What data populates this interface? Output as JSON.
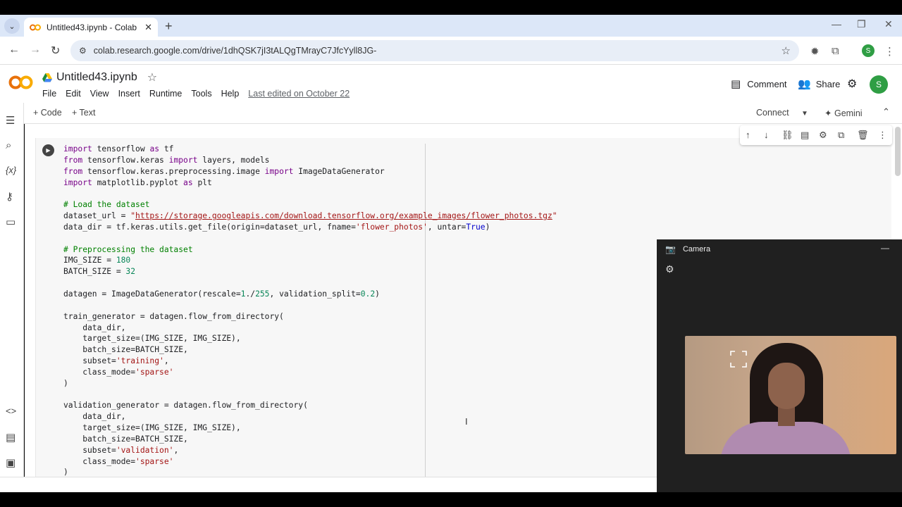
{
  "browser": {
    "tab_title": "Untitled43.ipynb - Colab",
    "url": "colab.research.google.com/drive/1dhQSK7jI3tALQgTMrayC7JfcYyll8JG-",
    "profile_initial": "S",
    "accent": "#dce7f8"
  },
  "colab": {
    "logo": "CO",
    "notebook_name": "Untitled43.ipynb",
    "menus": [
      "File",
      "Edit",
      "View",
      "Insert",
      "Runtime",
      "Tools",
      "Help"
    ],
    "last_edited": "Last edited on October 22",
    "comment_label": "Comment",
    "share_label": "Share",
    "avatar_initial": "S",
    "add_code_label": "+ Code",
    "add_text_label": "+ Text",
    "connect_label": "Connect",
    "gemini_label": "Gemini"
  },
  "code_lines": [
    "import tensorflow as tf",
    "from tensorflow.keras import layers, models",
    "from tensorflow.keras.preprocessing.image import ImageDataGenerator",
    "import matplotlib.pyplot as plt",
    "",
    "# Load the dataset",
    "dataset_url = \"https://storage.googleapis.com/download.tensorflow.org/example_images/flower_photos.tgz\"",
    "data_dir = tf.keras.utils.get_file(origin=dataset_url, fname='flower_photos', untar=True)",
    "",
    "# Preprocessing the dataset",
    "IMG_SIZE = 180",
    "BATCH_SIZE = 32",
    "",
    "datagen = ImageDataGenerator(rescale=1./255, validation_split=0.2)",
    "",
    "train_generator = datagen.flow_from_directory(",
    "    data_dir,",
    "    target_size=(IMG_SIZE, IMG_SIZE),",
    "    batch_size=BATCH_SIZE,",
    "    subset='training',",
    "    class_mode='sparse'",
    ")",
    "",
    "validation_generator = datagen.flow_from_directory(",
    "    data_dir,",
    "    target_size=(IMG_SIZE, IMG_SIZE),",
    "    batch_size=BATCH_SIZE,",
    "    subset='validation',",
    "    class_mode='sparse'",
    ")"
  ],
  "camera": {
    "title": "Camera"
  },
  "icons": {
    "rail": [
      "toc-icon",
      "search-icon",
      "variables-icon",
      "secrets-icon",
      "files-icon",
      "code-snippets-icon",
      "command-palette-icon",
      "terminal-icon"
    ],
    "cell_tools": [
      "move-up-icon",
      "move-down-icon",
      "link-icon",
      "comment-icon",
      "settings-icon",
      "mirror-cell-icon",
      "delete-icon",
      "more-icon"
    ]
  }
}
